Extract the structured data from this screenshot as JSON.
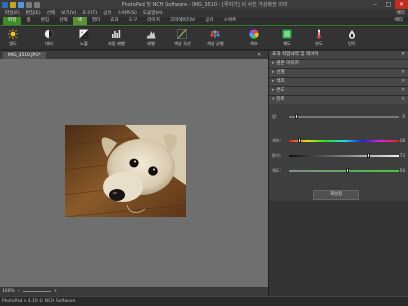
{
  "window": {
    "title": "PhotoPad 및 NCH Software - IMG_3510 - [루이기] 이 사진 가상화한 이미",
    "win_buttons": [
      "–",
      "□",
      "✕"
    ]
  },
  "menu": {
    "items": [
      "파일(F)",
      "편집(E)",
      "선택",
      "보기(V)",
      "도구(T)",
      "공유",
      "스위트(S)",
      "도움말(H)"
    ],
    "right": "베타"
  },
  "ribbon_tabs": {
    "items": [
      "파일",
      "홈",
      "편집",
      "선택",
      "색",
      "필터",
      "효과",
      "도구",
      "라이치",
      "크리에이티브",
      "공유",
      "스위트"
    ],
    "right": "베타",
    "active": "색"
  },
  "toolbar": {
    "tools": [
      {
        "label": "명도",
        "icon": "brightness-sun-icon"
      },
      {
        "label": "대비",
        "icon": "contrast-icon"
      },
      {
        "label": "노출",
        "icon": "exposure-icon"
      },
      {
        "label": "자동 레벨",
        "icon": "auto-levels-icon"
      },
      {
        "label": "레벨",
        "icon": "levels-icon"
      },
      {
        "label": "색상 곡선",
        "icon": "color-curves-icon"
      },
      {
        "label": "색상 균형",
        "icon": "color-balance-icon"
      },
      {
        "label": "색조",
        "icon": "hue-wheel-icon"
      },
      {
        "label": "채도",
        "icon": "saturation-icon"
      },
      {
        "label": "온도",
        "icon": "temperature-icon"
      },
      {
        "label": "틴트",
        "icon": "tint-icon"
      }
    ]
  },
  "document": {
    "tab_label": "IMG_3510.JPG*",
    "close": "✕"
  },
  "zoom": {
    "percent": "100%",
    "minus": "–",
    "plus": "+"
  },
  "status": {
    "text": "PhotoPad v 4.10 © NCH Software"
  },
  "panel": {
    "title": "효과 적업내역 및 레이어",
    "close": "✕",
    "sections": [
      {
        "label": "원본 이미지"
      },
      {
        "label": "선명"
      },
      {
        "label": "색조"
      },
      {
        "label": "온도"
      },
      {
        "label": "틴트"
      }
    ],
    "tint": {
      "sliders": [
        {
          "label": "양:",
          "value": "0",
          "fraction": 0.07
        },
        {
          "label": "색조:",
          "value": "18",
          "fraction": 0.1
        },
        {
          "label": "밝기:",
          "value": "73",
          "fraction": 0.73
        },
        {
          "label": "채도:",
          "value": "54",
          "fraction": 0.54
        }
      ],
      "reset_label": "재설정"
    }
  },
  "colors": {
    "accent_green": "#3f8a2b",
    "panel_bg": "#3a3a3a",
    "canvas_bg": "#6f6f6f"
  }
}
